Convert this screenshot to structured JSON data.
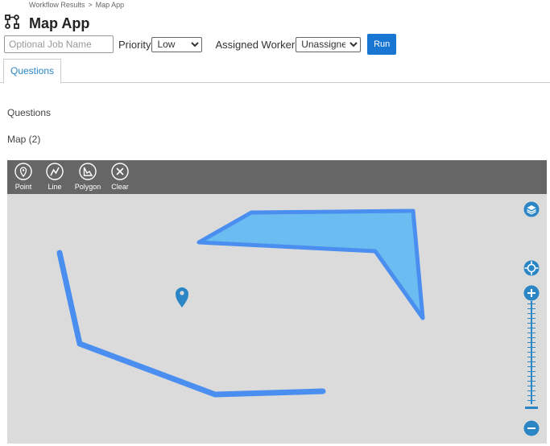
{
  "breadcrumb": {
    "parent": "Workflow Results",
    "separator": ">",
    "current": "Map App"
  },
  "header": {
    "title": "Map App"
  },
  "controls": {
    "job_name": {
      "value": "",
      "placeholder": "Optional Job Name"
    },
    "priority": {
      "label": "Priority",
      "selected": "Low"
    },
    "assigned_worker": {
      "label": "Assigned Worker",
      "selected": "Unassigned"
    },
    "run_label": "Run"
  },
  "tabs": [
    {
      "label": "Questions",
      "active": true
    }
  ],
  "sections": {
    "questions": "Questions",
    "map": "Map (2)"
  },
  "map": {
    "tools": [
      {
        "label": "Point",
        "icon": "point-icon"
      },
      {
        "label": "Line",
        "icon": "line-icon"
      },
      {
        "label": "Polygon",
        "icon": "polygon-icon"
      },
      {
        "label": "Clear",
        "icon": "clear-icon"
      }
    ],
    "controls": [
      "layers-icon",
      "locate-icon",
      "zoom-in-icon",
      "zoom-slider",
      "zoom-out-icon"
    ]
  },
  "colors": {
    "accent": "#1976d2",
    "tab_text": "#2a86c5",
    "toolbar_bg": "#666666",
    "map_bg": "#dbdbdb",
    "shape_stroke": "#4a8ef0",
    "polygon_fill": "#6bbcf0"
  }
}
